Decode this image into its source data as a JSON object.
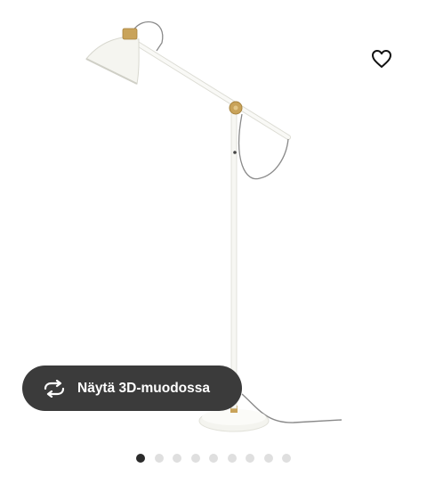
{
  "gallery": {
    "image_subject": "floor-lamp",
    "favourite_icon": "heart-outline-icon",
    "view_3d": {
      "label": "Näytä 3D-muodossa",
      "icon": "rotate-arrows-icon"
    },
    "pagination": {
      "total": 9,
      "active_index": 0
    }
  }
}
